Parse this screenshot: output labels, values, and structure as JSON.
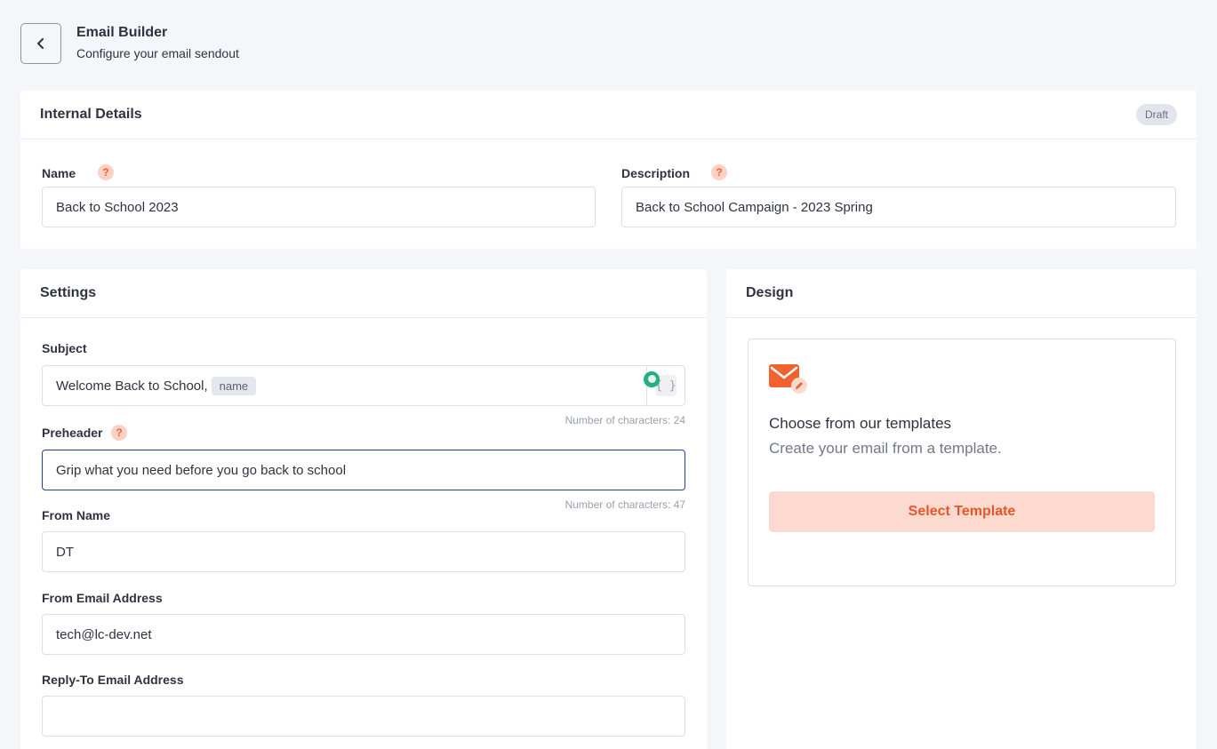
{
  "header": {
    "title": "Email Builder",
    "subtitle": "Configure your email sendout"
  },
  "internal_details": {
    "title": "Internal Details",
    "status_badge": "Draft",
    "name_label": "Name",
    "name_value": "Back to School 2023",
    "description_label": "Description",
    "description_value": "Back to School Campaign - 2023 Spring"
  },
  "settings": {
    "title": "Settings",
    "subject_label": "Subject",
    "subject_value": "Welcome Back to School,",
    "subject_token": "name",
    "subject_counter": "Number of characters: 24",
    "merge_tag_glyph": "{ }",
    "preheader_label": "Preheader",
    "preheader_value": "Grip what you need before you go back to school",
    "preheader_counter": "Number of characters: 47",
    "from_name_label": "From Name",
    "from_name_value": "DT",
    "from_email_label": "From Email Address",
    "from_email_value": "tech@lc-dev.net",
    "reply_to_label": "Reply-To Email Address",
    "reply_to_value": ""
  },
  "design": {
    "title": "Design",
    "template_title": "Choose from our templates",
    "template_subtitle": "Create your email from a template.",
    "select_button": "Select Template"
  },
  "icons": {
    "back": "chevron-left-icon",
    "help": "question-icon",
    "mail": "envelope-edit-icon"
  },
  "colors": {
    "accent": "#f0622f",
    "accent_light": "#fddad0",
    "focus_border": "#2c3e8f",
    "success": "#22b07d"
  }
}
